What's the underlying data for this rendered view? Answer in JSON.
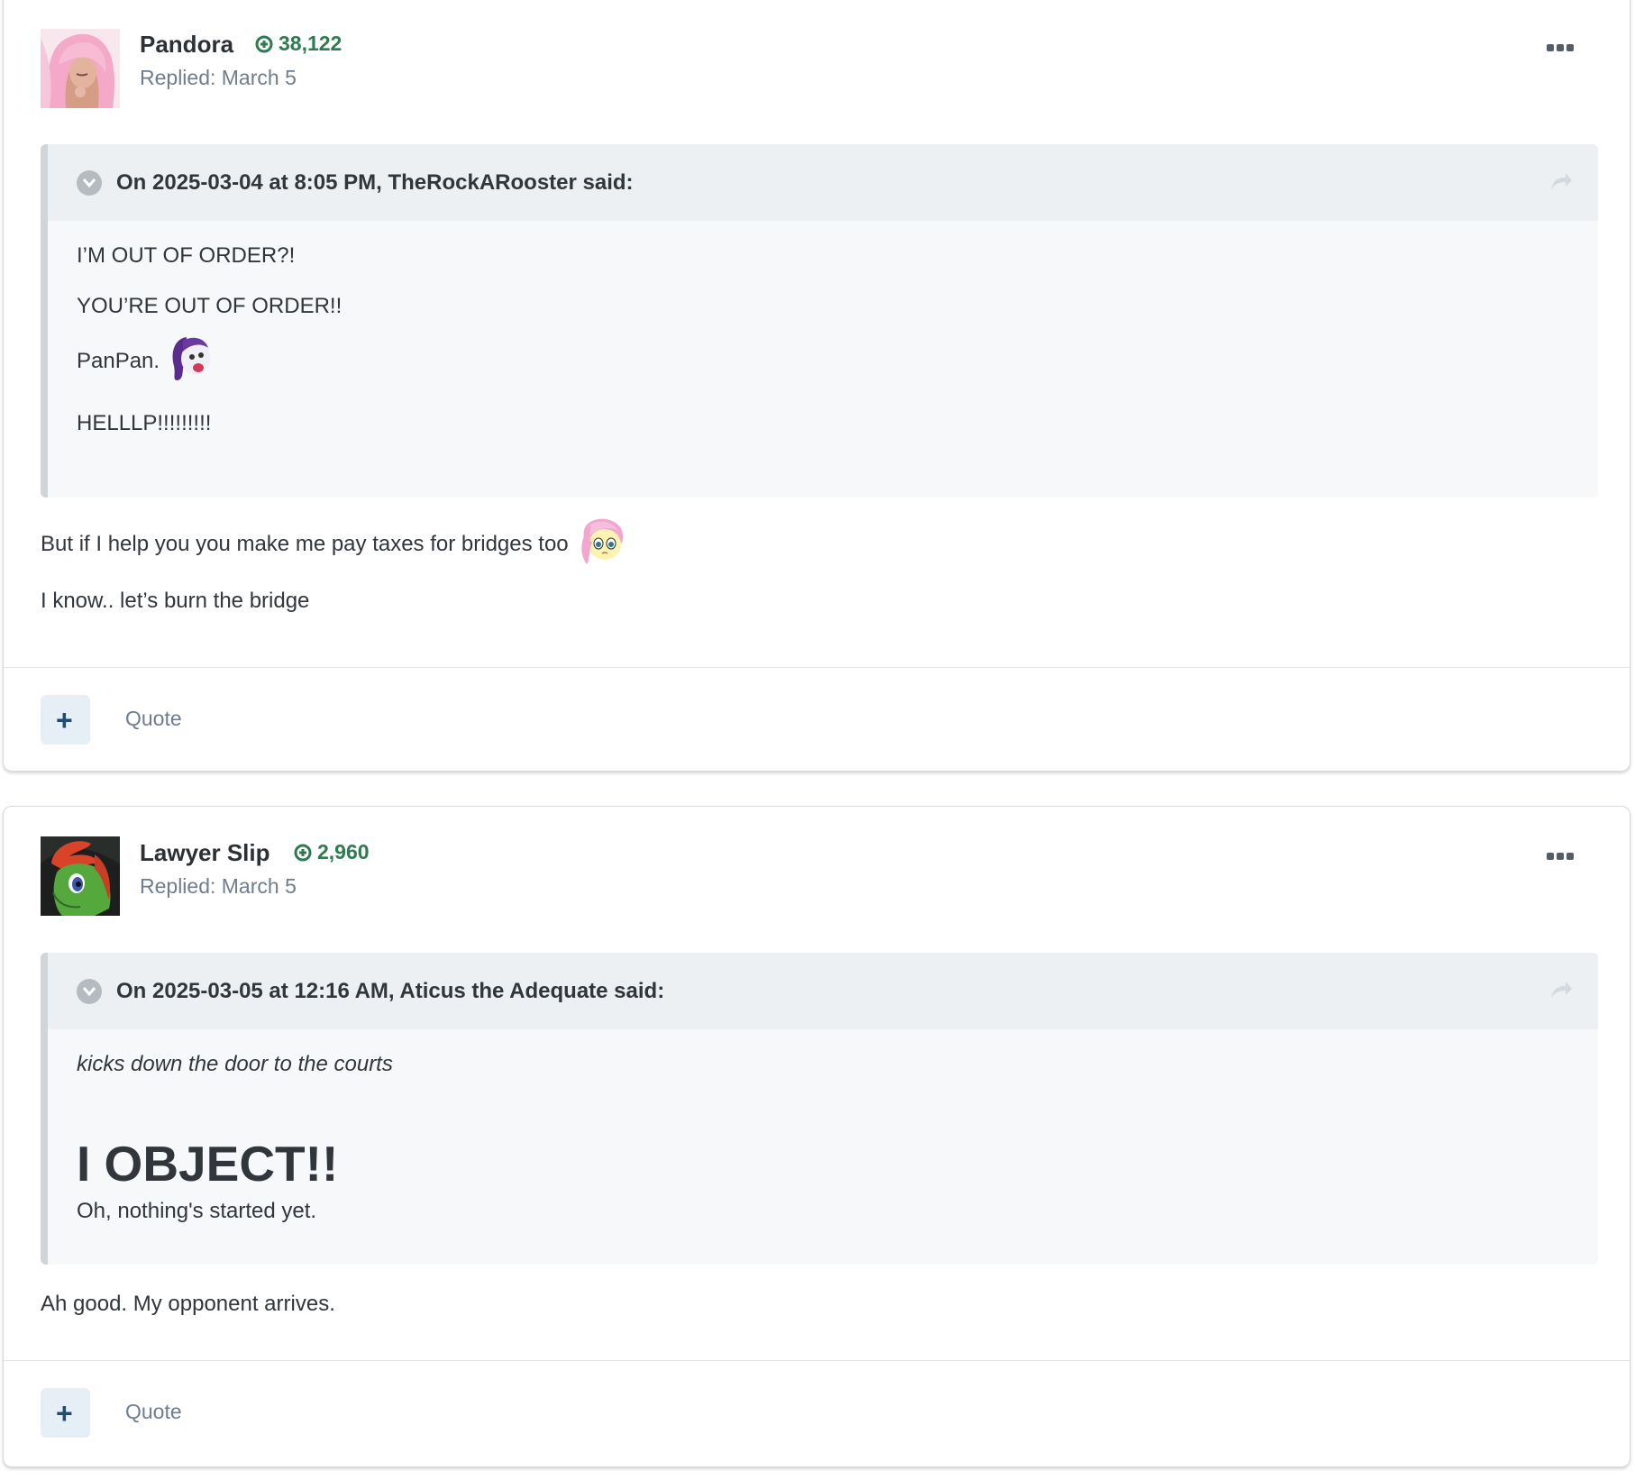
{
  "posts": [
    {
      "author": "Pandora",
      "reputation": "38,122",
      "replied": "Replied: March 5",
      "quote": {
        "cite": "On 2025-03-04 at 8:05 PM, TheRockARooster said:",
        "lines": [
          "I’M OUT OF ORDER?!",
          "YOU’RE OUT OF ORDER!!",
          "PanPan.",
          "HELLLP!!!!!!!!!"
        ]
      },
      "body": [
        "But if I help you you make me pay taxes for bridges too",
        "I know.. let’s burn the bridge"
      ],
      "quote_button": "Quote"
    },
    {
      "author": "Lawyer Slip",
      "reputation": "2,960",
      "replied": "Replied: March 5",
      "quote": {
        "cite": "On 2025-03-05 at 12:16 AM, Aticus the Adequate said:",
        "lines": [
          "kicks down the door to the courts",
          "I OBJECT!!",
          "Oh, nothing's started yet."
        ]
      },
      "body": [
        "Ah good. My opponent arrives."
      ],
      "quote_button": "Quote"
    }
  ],
  "colors": {
    "reputation": "#2f7a51",
    "quote_background": "#f7f8fa",
    "quote_header": "#edf0f3",
    "react_button": "#e6eef6"
  },
  "icons": {
    "reputation": "plus-circle-icon",
    "menu": "ellipsis-icon",
    "quote_toggle": "chevron-down-circle-icon",
    "quote_share": "share-arrow-icon",
    "react": "plus-icon"
  }
}
